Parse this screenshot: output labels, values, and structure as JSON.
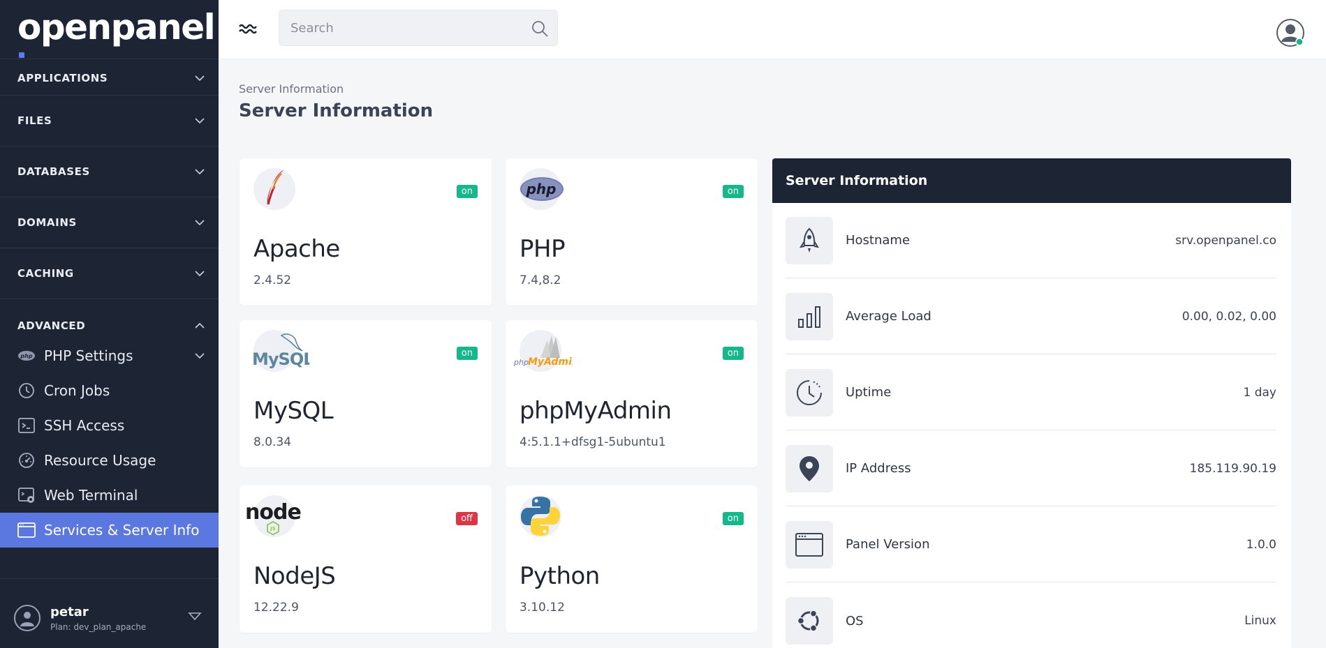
{
  "brand": {
    "logo_text": "openpanel",
    "accent": "#5b7cf0"
  },
  "sidebar": {
    "sections": [
      {
        "label": "APPLICATIONS"
      },
      {
        "label": "FILES"
      },
      {
        "label": "DATABASES"
      },
      {
        "label": "DOMAINS"
      },
      {
        "label": "CACHING"
      },
      {
        "label": "ADVANCED"
      }
    ],
    "items": [
      {
        "label": "PHP Settings",
        "icon": "php-icon"
      },
      {
        "label": "Cron Jobs",
        "icon": "clock-icon"
      },
      {
        "label": "SSH Access",
        "icon": "terminal-icon"
      },
      {
        "label": "Resource Usage",
        "icon": "gauge-icon"
      },
      {
        "label": "Web Terminal",
        "icon": "web-terminal-icon"
      },
      {
        "label": "Services & Server Info",
        "icon": "window-icon",
        "active": true
      }
    ],
    "user": {
      "name": "petar",
      "plan": "Plan: dev_plan_apache"
    },
    "bg": "#1d2434",
    "active_color": "#5a78e0"
  },
  "topbar": {
    "search_placeholder": "Search"
  },
  "page": {
    "breadcrumb": "Server Information",
    "title": "Server Information"
  },
  "services": [
    {
      "name": "Apache",
      "version": "2.4.52",
      "status": "on"
    },
    {
      "name": "PHP",
      "version": "7.4,8.2",
      "status": "on"
    },
    {
      "name": "MySQL",
      "version": "8.0.34",
      "status": "on"
    },
    {
      "name": "phpMyAdmin",
      "version": "4:5.1.1+dfsg1-5ubuntu1",
      "status": "on"
    },
    {
      "name": "NodeJS",
      "version": "12.22.9",
      "status": "off"
    },
    {
      "name": "Python",
      "version": "3.10.12",
      "status": "on"
    }
  ],
  "logo_text": {
    "php": "php",
    "mysql": "MySQL",
    "pma_small": "php",
    "pma_big": "MyAdmin",
    "node": "node",
    "js": "JS"
  },
  "server_info": {
    "title": "Server Information",
    "rows": [
      {
        "label": "Hostname",
        "value": "srv.openpanel.co",
        "icon": "rocket-icon"
      },
      {
        "label": "Average Load",
        "value": "0.00, 0.02, 0.00",
        "icon": "bar-chart-icon"
      },
      {
        "label": "Uptime",
        "value": "1 day",
        "icon": "clock-icon"
      },
      {
        "label": "IP Address",
        "value": "185.119.90.19",
        "icon": "location-pin-icon"
      },
      {
        "label": "Panel Version",
        "value": "1.0.0",
        "icon": "browser-window-icon"
      },
      {
        "label": "OS",
        "value": "Linux",
        "icon": "ubuntu-icon"
      }
    ]
  },
  "status_colors": {
    "on": "#14b88a",
    "off": "#dc3545"
  }
}
